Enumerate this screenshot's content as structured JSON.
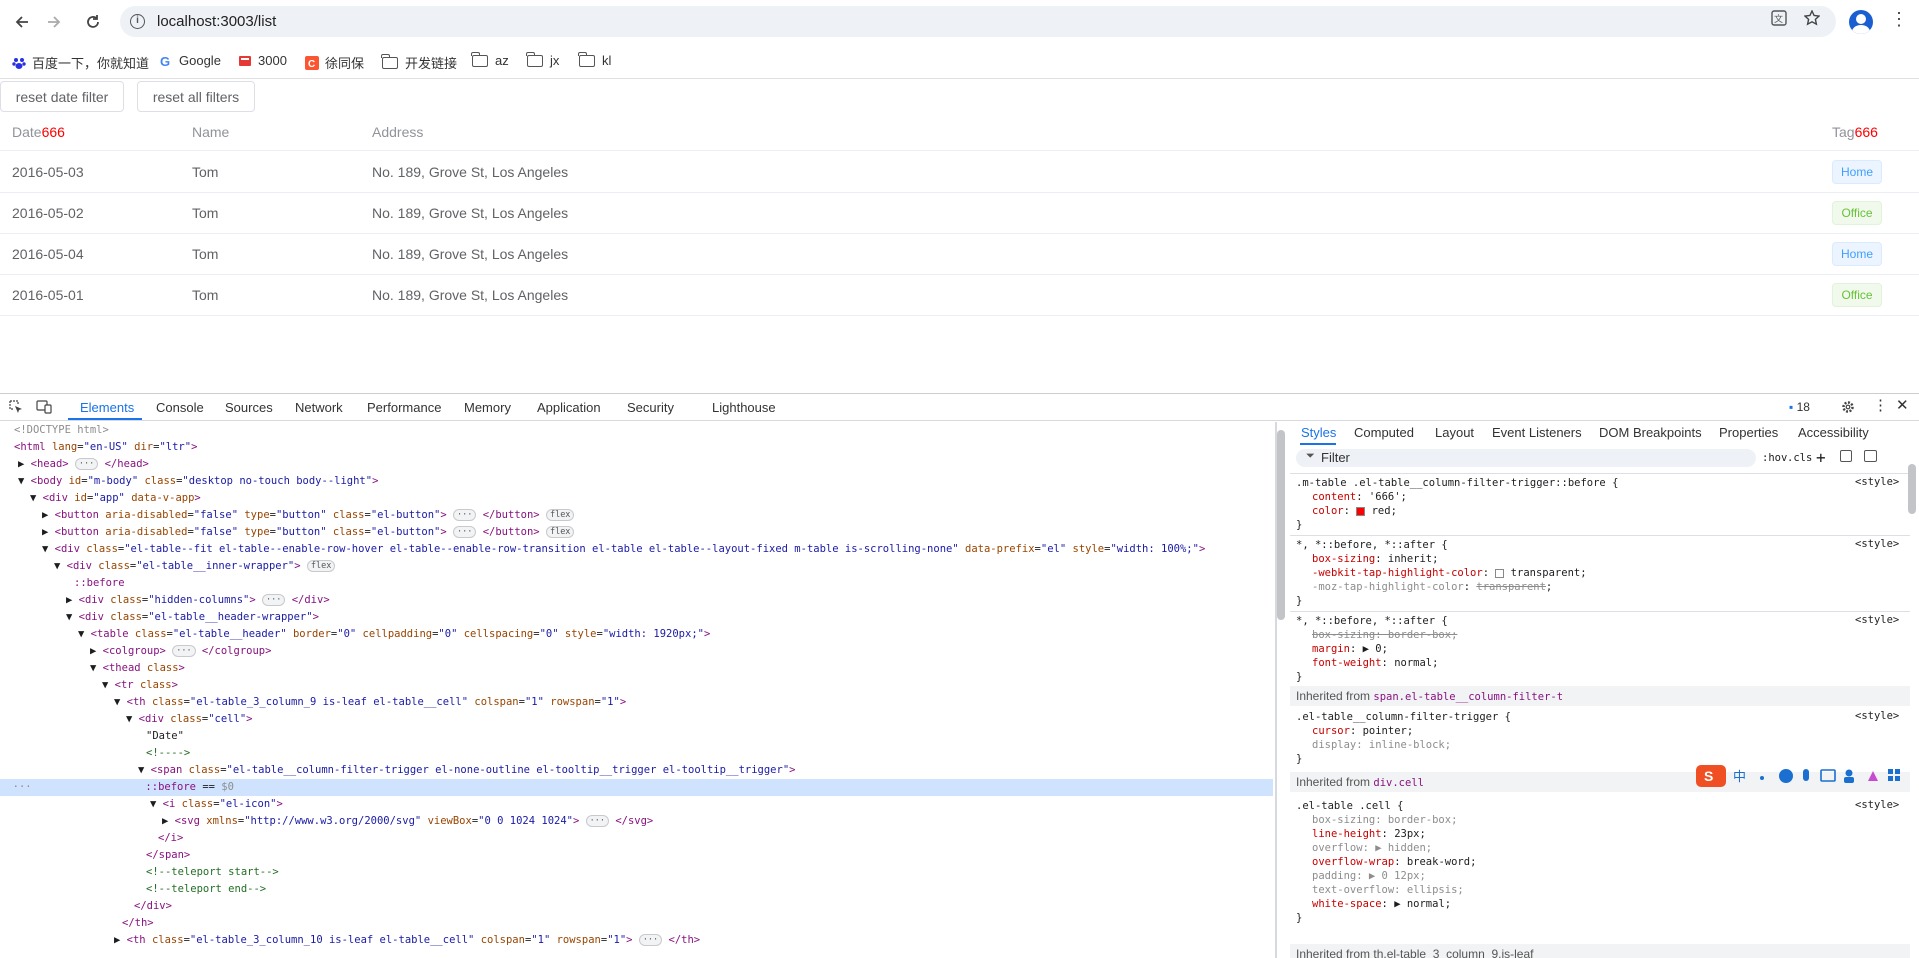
{
  "browser": {
    "url": "localhost:3003/list",
    "bookmarks": [
      {
        "label": "百度一下，你就知道",
        "icon": "baidu-icon"
      },
      {
        "label": "Google",
        "icon": "google-icon"
      },
      {
        "label": "3000",
        "icon": "site-icon"
      },
      {
        "label": "徐同保",
        "icon": "csdn-icon"
      },
      {
        "label": "开发链接",
        "icon": "folder-icon"
      },
      {
        "label": "az",
        "icon": "folder-icon"
      },
      {
        "label": "jx",
        "icon": "folder-icon"
      },
      {
        "label": "kl",
        "icon": "folder-icon"
      }
    ]
  },
  "page": {
    "buttons": {
      "reset_date": "reset date filter",
      "reset_all": "reset all filters"
    },
    "columns": {
      "date": "Date",
      "date_suffix": "666",
      "name": "Name",
      "address": "Address",
      "tag": "Tag",
      "tag_suffix": "666"
    },
    "rows": [
      {
        "date": "2016-05-03",
        "name": "Tom",
        "address": "No. 189, Grove St, Los Angeles",
        "tag": "Home"
      },
      {
        "date": "2016-05-02",
        "name": "Tom",
        "address": "No. 189, Grove St, Los Angeles",
        "tag": "Office"
      },
      {
        "date": "2016-05-04",
        "name": "Tom",
        "address": "No. 189, Grove St, Los Angeles",
        "tag": "Home"
      },
      {
        "date": "2016-05-01",
        "name": "Tom",
        "address": "No. 189, Grove St, Los Angeles",
        "tag": "Office"
      }
    ]
  },
  "devtools": {
    "tabs": [
      "Elements",
      "Console",
      "Sources",
      "Network",
      "Performance",
      "Memory",
      "Application",
      "Security",
      "Lighthouse"
    ],
    "issues_count": "18",
    "styles_tabs": [
      "Styles",
      "Computed",
      "Layout",
      "Event Listeners",
      "DOM Breakpoints",
      "Properties",
      "Accessibility"
    ],
    "filter_placeholder": "Filter",
    "filter_hov": ":hov",
    "filter_cls": ".cls",
    "style_source": "<style>",
    "inherited_1_label": "Inherited from",
    "inherited_1_sel": "span.el-table__column-filter-t",
    "inherited_2_label": "Inherited from",
    "inherited_2_sel": "div.cell",
    "inherited_3": "Inherited from th.el-table_3_column_9.is-leaf"
  }
}
